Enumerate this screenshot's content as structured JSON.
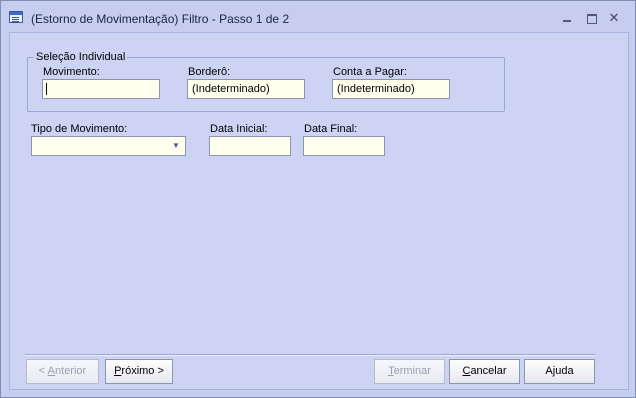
{
  "window": {
    "title": "(Estorno de Movimentação) Filtro - Passo 1 de 2",
    "close_glyph": "✕",
    "icons": [
      "app-form-icon",
      "minimize-icon",
      "maximize-icon",
      "close-icon"
    ]
  },
  "group": {
    "title": "Seleção Individual",
    "movimento_label": "Movimento:",
    "movimento_value": "",
    "bordero_label": "Borderô:",
    "bordero_value": "(Indeterminado)",
    "conta_label": "Conta a Pagar:",
    "conta_value": "(Indeterminado)"
  },
  "filters": {
    "tipo_label": "Tipo de Movimento:",
    "tipo_value": "",
    "tipo_arrow": "▼",
    "data_inicial_label": "Data Inicial:",
    "data_inicial_value": "",
    "data_final_label": "Data Final:",
    "data_final_value": ""
  },
  "buttons": {
    "anterior": {
      "prefix": "< ",
      "mnemonic": "A",
      "rest": "nterior",
      "enabled": false
    },
    "proximo": {
      "mnemonic": "P",
      "rest": "róximo >",
      "enabled": true
    },
    "terminar": {
      "mnemonic": "T",
      "rest": "erminar",
      "enabled": false
    },
    "cancelar": {
      "mnemonic": "C",
      "rest": "ancelar",
      "enabled": true
    },
    "ajuda": {
      "label": "Ajuda",
      "enabled": true
    }
  },
  "colors": {
    "window_bg": "#c6cdee",
    "content_bg": "#cdd3f3",
    "field_bg": "#ffffee",
    "disabled_text": "#9aa0b0"
  }
}
